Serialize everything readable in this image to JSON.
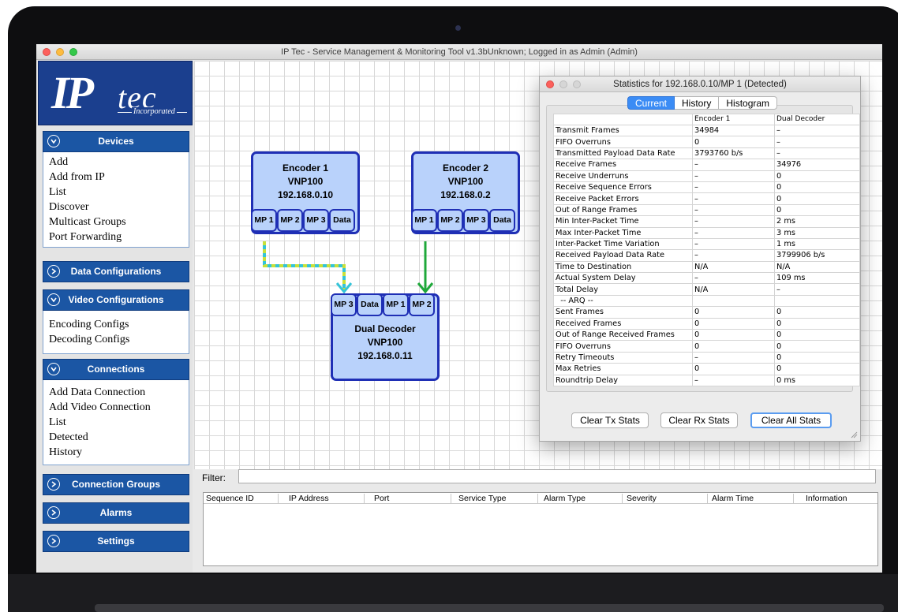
{
  "window": {
    "title": "IP Tec - Service Management & Monitoring Tool v1.3bUnknown; Logged in as Admin (Admin)",
    "traffic_colors": [
      "#fc605c",
      "#fdbc40",
      "#34c84a"
    ]
  },
  "logo": {
    "main": "IP",
    "tec": "tec",
    "sub": "Incorporated"
  },
  "sidebar": {
    "devices": {
      "title": "Devices",
      "items": [
        "Add",
        "Add from IP",
        "List",
        "Discover",
        "Multicast Groups",
        "Port Forwarding"
      ]
    },
    "data_configurations": {
      "title": "Data Configurations"
    },
    "video_configurations": {
      "title": "Video Configurations",
      "items": [
        "Encoding Configs",
        "Decoding Configs"
      ]
    },
    "connections": {
      "title": "Connections",
      "items": [
        "Add Data Connection",
        "Add Video Connection",
        "List",
        "Detected",
        "History"
      ]
    },
    "connection_groups": {
      "title": "Connection Groups"
    },
    "alarms": {
      "title": "Alarms"
    },
    "settings": {
      "title": "Settings"
    }
  },
  "nodes": {
    "encoder1": {
      "name": "Encoder 1",
      "model": "VNP100",
      "ip": "192.168.0.10",
      "ports": [
        "MP 1",
        "MP 2",
        "MP 3",
        "Data"
      ]
    },
    "encoder2": {
      "name": "Encoder 2",
      "model": "VNP100",
      "ip": "192.168.0.2",
      "ports": [
        "MP 1",
        "MP 2",
        "MP 3",
        "Data"
      ]
    },
    "decoder": {
      "name": "Dual Decoder",
      "model": "VNP100",
      "ip": "192.168.0.11",
      "ports": [
        "MP 3",
        "Data",
        "MP 1",
        "MP 2"
      ]
    }
  },
  "connection_colors": {
    "encoder1_to_decoder": "#34c4d8",
    "encoder1_dash": "#c8e03a",
    "encoder2_to_decoder": "#1fa83a"
  },
  "filter": {
    "label": "Filter:",
    "value": ""
  },
  "alarm_table": {
    "columns": [
      "Sequence ID",
      "IP Address",
      "Port",
      "Service Type",
      "Alarm Type",
      "Severity",
      "Alarm Time",
      "Information"
    ]
  },
  "stats_dialog": {
    "title": "Statistics for 192.168.0.10/MP 1 (Detected)",
    "tabs": [
      "Current",
      "History",
      "Histogram"
    ],
    "active_tab": "Current",
    "columns": [
      "",
      "Encoder 1",
      "Dual Decoder"
    ],
    "rows": [
      [
        "Transmit Frames",
        "34984",
        "–"
      ],
      [
        "FIFO Overruns",
        "0",
        "–"
      ],
      [
        "Transmitted Payload Data Rate",
        "3793760 b/s",
        "–"
      ],
      [
        "Receive Frames",
        "–",
        "34976"
      ],
      [
        "Receive Underruns",
        "–",
        "0"
      ],
      [
        "Receive Sequence Errors",
        "–",
        "0"
      ],
      [
        "Receive Packet Errors",
        "–",
        "0"
      ],
      [
        "Out of Range Frames",
        "–",
        "0"
      ],
      [
        "Min Inter-Packet Time",
        "–",
        "2 ms"
      ],
      [
        "Max Inter-Packet Time",
        "–",
        "3 ms"
      ],
      [
        "Inter-Packet Time Variation",
        "–",
        "1 ms"
      ],
      [
        "Received Payload Data Rate",
        "–",
        "3799906 b/s"
      ],
      [
        "Time to Destination",
        "N/A",
        "N/A"
      ],
      [
        "Actual System Delay",
        "–",
        "109 ms"
      ],
      [
        "Total Delay",
        "N/A",
        "–"
      ],
      [
        "  -- ARQ --",
        "",
        ""
      ],
      [
        "Sent Frames",
        "0",
        "0"
      ],
      [
        "Received Frames",
        "0",
        "0"
      ],
      [
        "Out of Range Received Frames",
        "0",
        "0"
      ],
      [
        "FIFO Overruns",
        "0",
        "0"
      ],
      [
        "Retry Timeouts",
        "–",
        "0"
      ],
      [
        "Max Retries",
        "0",
        "0"
      ],
      [
        "Roundtrip Delay",
        "–",
        "0 ms"
      ]
    ],
    "buttons": {
      "clear_tx": "Clear Tx Stats",
      "clear_rx": "Clear Rx Stats",
      "clear_all": "Clear All Stats"
    }
  }
}
